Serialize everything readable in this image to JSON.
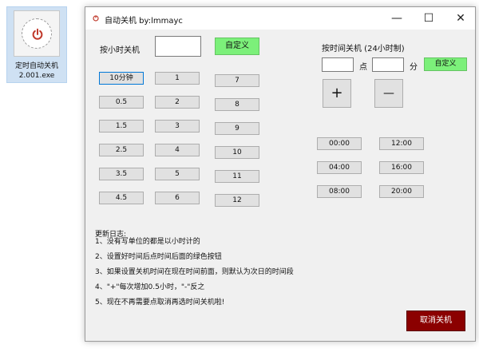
{
  "desktop": {
    "icon_label_line1": "定时自动关机",
    "icon_label_line2": "2.001.exe",
    "accent": "#c0392b"
  },
  "window": {
    "title": "自动关机 by:lmmayc",
    "min": "—",
    "max": "☐",
    "close": "✕"
  },
  "hours_section": {
    "label": "按小时关机",
    "input_value": "",
    "custom_label": "自定义",
    "buttons": [
      [
        "10分钟",
        "1",
        "7"
      ],
      [
        "0.5",
        "2",
        "8"
      ],
      [
        "1.5",
        "3",
        "9"
      ],
      [
        "2.5",
        "4",
        "10"
      ],
      [
        "3.5",
        "5",
        "11"
      ],
      [
        "4.5",
        "6",
        "12"
      ]
    ]
  },
  "time_section": {
    "label": "按时间关机 (24小时制)",
    "hour_value": "",
    "hour_unit": "点",
    "minute_value": "",
    "minute_unit": "分",
    "custom_label": "自定义",
    "plus": "+",
    "minus": "—",
    "presets": [
      [
        "00:00",
        "12:00"
      ],
      [
        "04:00",
        "16:00"
      ],
      [
        "08:00",
        "20:00"
      ]
    ]
  },
  "changelog": {
    "title": "更新日志:",
    "lines": [
      "1、没有写单位的都是以小时计的",
      "2、设置好时间后点时间后面的绿色按钮",
      "3、如果设置关机时间在现在时间前面，则默认为次日的时间段",
      "4、\"+\"每次增加0.5小时，\"-\"反之",
      "5、现在不再需要点取消再选时间关机啦!"
    ]
  },
  "cancel_label": "取消关机",
  "colors": {
    "green_button": "#7cf07a",
    "cancel_button": "#8b0000"
  }
}
